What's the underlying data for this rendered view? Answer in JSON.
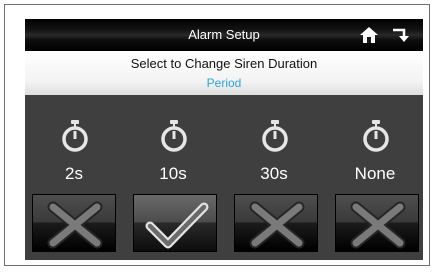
{
  "header": {
    "title": "Alarm Setup"
  },
  "instruction": "Select to Change Siren Duration",
  "subtitle": "Period",
  "options": [
    {
      "label": "2s",
      "icon": "stopwatch-icon",
      "state": "x-mark-icon"
    },
    {
      "label": "10s",
      "icon": "stopwatch-icon",
      "state": "checkmark-icon",
      "selected": true
    },
    {
      "label": "30s",
      "icon": "stopwatch-icon",
      "state": "x-mark-icon"
    },
    {
      "label": "None",
      "icon": "stopwatch-icon",
      "state": "x-mark-icon"
    }
  ],
  "colors": {
    "accent": "#29a4e0",
    "background": "#3f3f3f",
    "text": "#ffffff"
  }
}
